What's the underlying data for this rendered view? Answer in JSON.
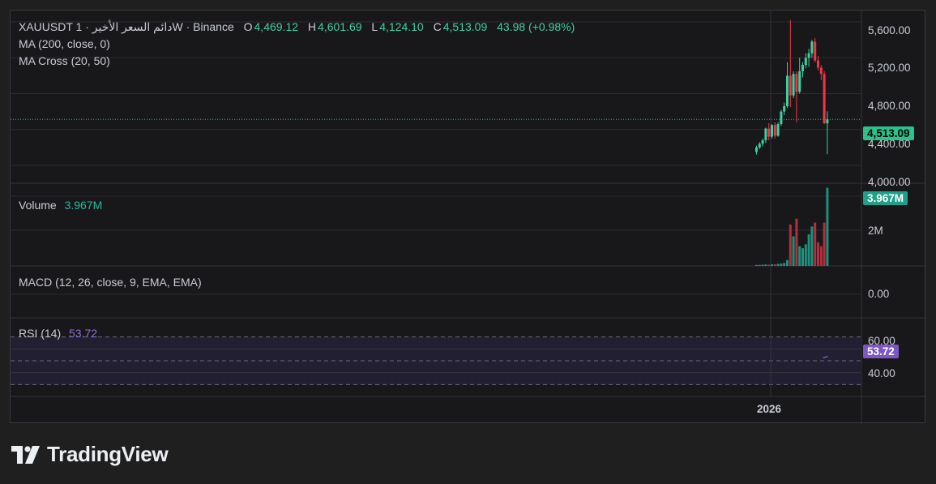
{
  "header": {
    "symbol_line": "XAUUSDT 1 · دائم السعر الأخيرW · Binance",
    "o_label": "O",
    "o_value": "4,469.12",
    "h_label": "H",
    "h_value": "4,601.69",
    "l_label": "L",
    "l_value": "4,124.10",
    "c_label": "C",
    "c_value": "4,513.09",
    "change": "43.98 (+0.98%)"
  },
  "indicators": {
    "ma": "MA (200, close, 0)",
    "ma_cross": "MA Cross (20, 50)",
    "volume_label": "Volume",
    "volume_value": "3.967M",
    "macd": "MACD (12, 26, close, 9, EMA, EMA)",
    "rsi_label": "RSI (14)",
    "rsi_value": "53.72"
  },
  "price_axis": {
    "ticks": [
      "5,600.00",
      "5,200.00",
      "4,800.00",
      "4,400.00",
      "4,000.00"
    ],
    "last_price": "4,513.09"
  },
  "volume_axis": {
    "ticks": [
      "2M"
    ],
    "last": "3.967M"
  },
  "macd_axis": {
    "ticks": [
      "0.00"
    ]
  },
  "rsi_axis": {
    "ticks": [
      "60.00",
      "40.00"
    ],
    "last": "53.72"
  },
  "time_axis": {
    "label": "2026"
  },
  "brand": {
    "name": "TradingView"
  },
  "colors": {
    "up": "#26a69a",
    "up_bright": "#3fd0a0",
    "down": "#f23645",
    "rsi": "#7e57c2",
    "rsi_band": "#231f33"
  },
  "chart_data": {
    "type": "candlestick",
    "symbol": "XAUUSDT",
    "interval": "1W",
    "price_ylim": [
      3900,
      5700
    ],
    "rsi_value": 53.72,
    "rsi_bands": [
      30,
      50,
      70
    ],
    "candles": [
      {
        "o": 4150,
        "h": 4220,
        "l": 4120,
        "c": 4200,
        "v": 0.05
      },
      {
        "o": 4200,
        "h": 4260,
        "l": 4180,
        "c": 4240,
        "v": 0.05
      },
      {
        "o": 4240,
        "h": 4300,
        "l": 4210,
        "c": 4280,
        "v": 0.06
      },
      {
        "o": 4280,
        "h": 4420,
        "l": 4250,
        "c": 4410,
        "v": 0.07
      },
      {
        "o": 4410,
        "h": 4470,
        "l": 4280,
        "c": 4320,
        "v": 0.06
      },
      {
        "o": 4320,
        "h": 4460,
        "l": 4300,
        "c": 4450,
        "v": 0.08
      },
      {
        "o": 4450,
        "h": 4480,
        "l": 4300,
        "c": 4330,
        "v": 0.08
      },
      {
        "o": 4330,
        "h": 4480,
        "l": 4320,
        "c": 4460,
        "v": 0.1
      },
      {
        "o": 4460,
        "h": 4620,
        "l": 4440,
        "c": 4600,
        "v": 0.12
      },
      {
        "o": 4600,
        "h": 4700,
        "l": 4560,
        "c": 4660,
        "v": 0.15
      },
      {
        "o": 4660,
        "h": 5150,
        "l": 4640,
        "c": 5000,
        "v": 0.3
      },
      {
        "o": 5000,
        "h": 5620,
        "l": 4650,
        "c": 4780,
        "v": 2.1
      },
      {
        "o": 4780,
        "h": 5050,
        "l": 4750,
        "c": 5020,
        "v": 1.5
      },
      {
        "o": 5020,
        "h": 5050,
        "l": 4480,
        "c": 4820,
        "v": 2.4
      },
      {
        "o": 4820,
        "h": 5200,
        "l": 4800,
        "c": 5050,
        "v": 1.0
      },
      {
        "o": 5050,
        "h": 5150,
        "l": 4980,
        "c": 5120,
        "v": 0.9
      },
      {
        "o": 5120,
        "h": 5250,
        "l": 5080,
        "c": 5200,
        "v": 1.1
      },
      {
        "o": 5200,
        "h": 5300,
        "l": 5100,
        "c": 5250,
        "v": 1.6
      },
      {
        "o": 5250,
        "h": 5400,
        "l": 5200,
        "c": 5380,
        "v": 2.0
      },
      {
        "o": 5380,
        "h": 5420,
        "l": 5150,
        "c": 5170,
        "v": 2.2
      },
      {
        "o": 5170,
        "h": 5220,
        "l": 5060,
        "c": 5090,
        "v": 1.2
      },
      {
        "o": 5090,
        "h": 5120,
        "l": 4950,
        "c": 5020,
        "v": 1.0
      },
      {
        "o": 5020,
        "h": 5050,
        "l": 4460,
        "c": 4470,
        "v": 2.2
      },
      {
        "o": 4469,
        "h": 4602,
        "l": 4124,
        "c": 4513,
        "v": 3.967
      }
    ],
    "volume_unit": "M"
  }
}
